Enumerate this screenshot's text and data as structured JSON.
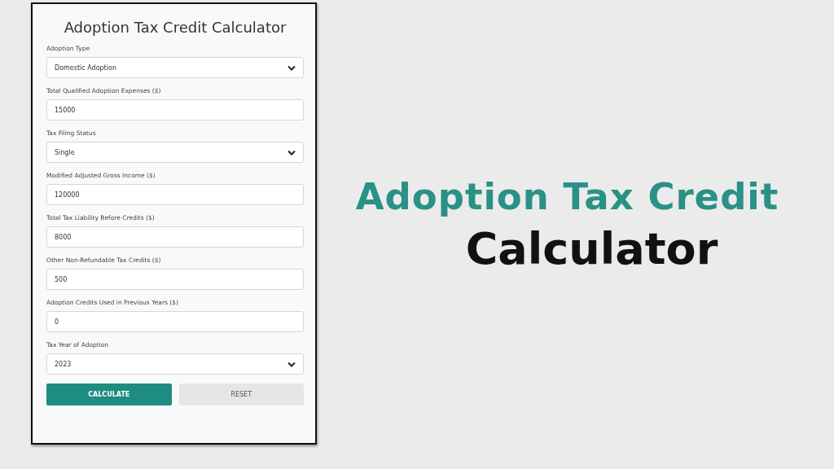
{
  "calculator": {
    "title": "Adoption Tax Credit Calculator",
    "fields": [
      {
        "kind": "select",
        "label": "Adoption Type",
        "value": "Domestic Adoption"
      },
      {
        "kind": "input",
        "label": "Total Qualified Adoption Expenses ($)",
        "value": "15000"
      },
      {
        "kind": "select",
        "label": "Tax Filing Status",
        "value": "Single"
      },
      {
        "kind": "input",
        "label": "Modified Adjusted Gross Income ($)",
        "value": "120000"
      },
      {
        "kind": "input",
        "label": "Total Tax Liability Before Credits ($)",
        "value": "8000"
      },
      {
        "kind": "input",
        "label": "Other Non-Refundable Tax Credits ($)",
        "value": "500"
      },
      {
        "kind": "input",
        "label": "Adoption Credits Used in Previous Years ($)",
        "value": "0"
      },
      {
        "kind": "select",
        "label": "Tax Year of Adoption",
        "value": "2023"
      }
    ],
    "buttons": [
      {
        "kind": "primary",
        "label": "CALCULATE"
      },
      {
        "kind": "secondary",
        "label": "RESET"
      }
    ]
  },
  "headline": {
    "line_1": "Adoption Tax Credit",
    "line_2": "Calculator"
  }
}
